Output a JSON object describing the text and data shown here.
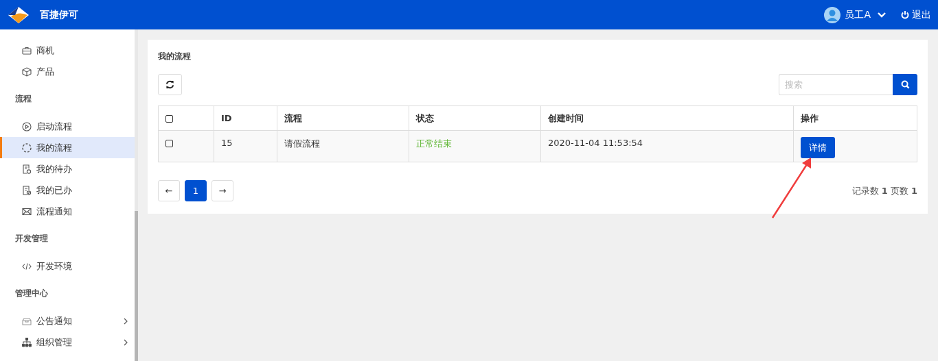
{
  "header": {
    "app_name": "百捷伊可",
    "user": "员工A",
    "logout": "退出"
  },
  "sidebar": {
    "groups": [
      {
        "items": [
          {
            "label": "商机",
            "selected": false,
            "has_submenu": false
          },
          {
            "label": "产品",
            "selected": false,
            "has_submenu": false
          }
        ]
      },
      {
        "title": "流程",
        "items": [
          {
            "label": "启动流程",
            "selected": false,
            "has_submenu": false
          },
          {
            "label": "我的流程",
            "selected": true,
            "has_submenu": false
          },
          {
            "label": "我的待办",
            "selected": false,
            "has_submenu": false
          },
          {
            "label": "我的已办",
            "selected": false,
            "has_submenu": false
          },
          {
            "label": "流程通知",
            "selected": false,
            "has_submenu": false
          }
        ]
      },
      {
        "title": "开发管理",
        "items": [
          {
            "label": "开发环境",
            "selected": false,
            "has_submenu": false
          }
        ]
      },
      {
        "title": "管理中心",
        "items": [
          {
            "label": "公告通知",
            "selected": false,
            "has_submenu": true
          },
          {
            "label": "组织管理",
            "selected": false,
            "has_submenu": true
          }
        ]
      }
    ]
  },
  "panel": {
    "title": "我的流程",
    "search": {
      "placeholder": "搜索"
    },
    "table": {
      "header_checked": false,
      "columns": [
        "ID",
        "流程",
        "状态",
        "创建时间",
        "操作"
      ],
      "rows": [
        {
          "checked": false,
          "id": "15",
          "process": "请假流程",
          "status": "正常结束",
          "color": "#5cb531",
          "created": "2020-11-04 11:53:54",
          "action": "详情"
        }
      ]
    },
    "pagination": {
      "prev": "←",
      "pages": [
        {
          "label": "1",
          "selected": true
        }
      ],
      "next": "→"
    },
    "summary": "记录数 **1** 页数 **1**"
  }
}
